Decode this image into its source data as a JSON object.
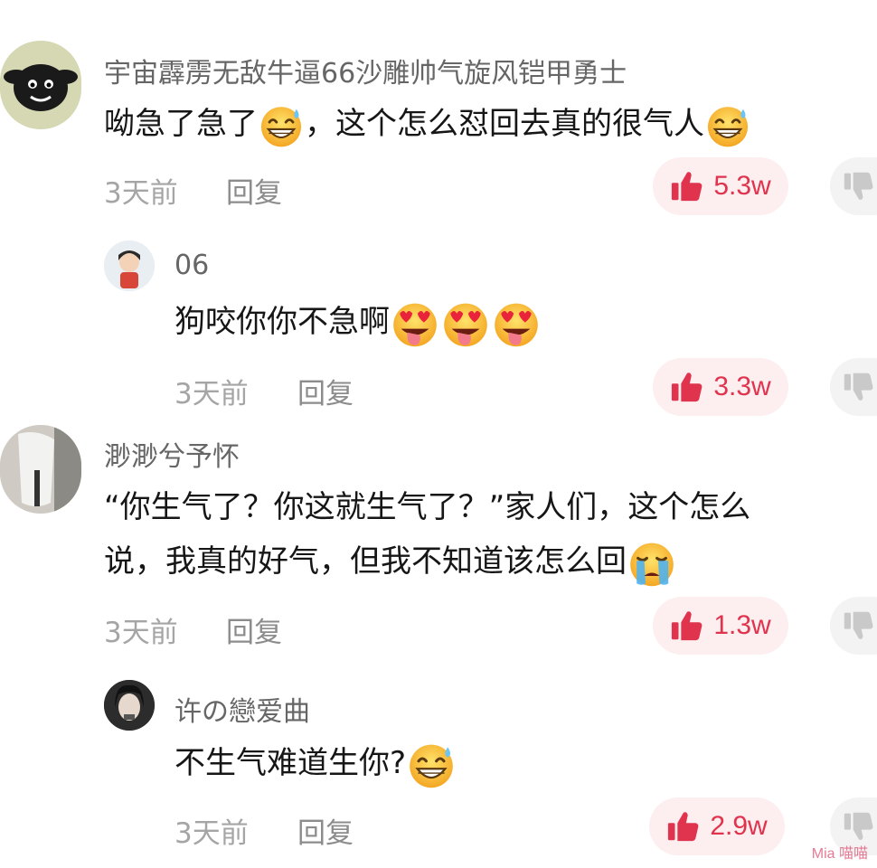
{
  "colors": {
    "like_red": "#e0334d",
    "like_bg": "#fdeef0",
    "meta_gray": "#a5a5a5"
  },
  "comments": [
    {
      "username": "宇宙霹雳无敌牛逼66沙雕帅气旋风铠甲勇士",
      "text_parts": [
        "呦急了急了",
        "，这个怎么怼回去真的很气人"
      ],
      "time": "3天前",
      "reply_label": "回复",
      "likes": "5.3w",
      "emoji": "grinning-sweat-emoji"
    },
    {
      "username": "06",
      "text_parts": [
        "狗咬你你不急啊"
      ],
      "time": "3天前",
      "reply_label": "回复",
      "likes": "3.3w",
      "emoji": "heart-eyes-tongue-emoji"
    },
    {
      "username": "渺渺兮予怀",
      "text_lines": [
        "“你生气了？你这就生气了？”家人们，这个怎么",
        "说，我真的好气，但我不知道该怎么回"
      ],
      "time": "3天前",
      "reply_label": "回复",
      "likes": "1.3w",
      "emoji": "crying-emoji"
    },
    {
      "username": "许の戀爱曲",
      "text_parts": [
        "不生气难道生你?"
      ],
      "time": "3天前",
      "reply_label": "回复",
      "likes": "2.9w",
      "emoji": "grinning-sweat-emoji"
    }
  ],
  "watermark": "Mia 喵喵"
}
